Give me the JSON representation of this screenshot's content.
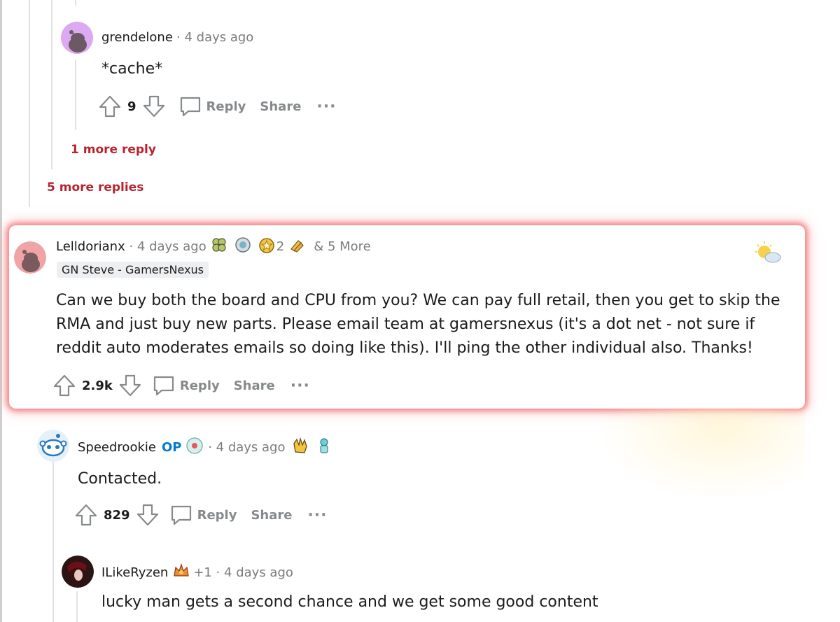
{
  "comments": [
    {
      "username": "grendelone",
      "time": "4 days ago",
      "body": "*cache*",
      "score": "9",
      "reply_label": "Reply",
      "share_label": "Share",
      "more_reply_link": "1 more reply"
    },
    {
      "more_replies_link": "5 more replies"
    },
    {
      "username": "Lelldorianx",
      "time": "4 days ago",
      "award_count": "2",
      "more_awards": "& 5 More",
      "flair": "GN Steve - GamersNexus",
      "body": "Can we buy both the board and CPU from you? We can pay full retail, then you get to skip the RMA and just buy new parts. Please email team at gamersnexus (it's a dot net - not sure if reddit auto moderates emails so doing like this). I'll ping the other individual also. Thanks!",
      "score": "2.9k",
      "reply_label": "Reply",
      "share_label": "Share"
    },
    {
      "username": "Speedrookie",
      "op_badge": "OP",
      "time": "4 days ago",
      "body": "Contacted.",
      "score": "829",
      "reply_label": "Reply",
      "share_label": "Share"
    },
    {
      "username": "ILikeRyzen",
      "award_extra": "+1",
      "time": "4 days ago",
      "body": "lucky man gets a second chance and we get some good content"
    }
  ],
  "icons": {
    "upvote": "arrow-up-icon",
    "downvote": "arrow-down-icon",
    "reply": "speech-bubble-icon",
    "more": "ellipsis-icon"
  },
  "colors": {
    "more_link": "#b8232f",
    "op_badge": "#0079d3",
    "highlight_glow": "#ee5050"
  }
}
